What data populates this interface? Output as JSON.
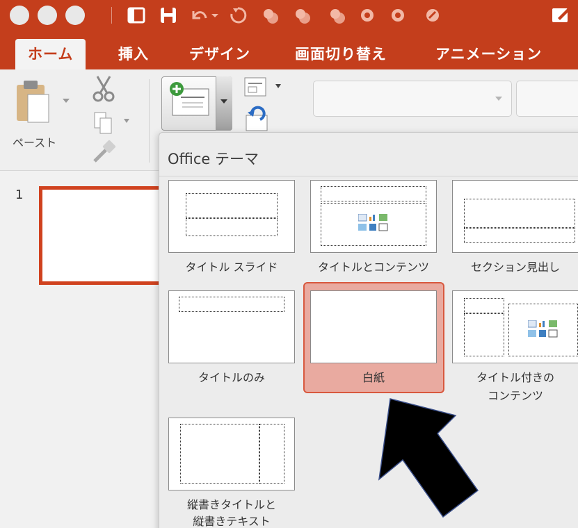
{
  "window": {
    "traffic_lights": [
      "close",
      "minimize",
      "zoom"
    ],
    "quick_access": [
      "sidebar-icon",
      "save-icon",
      "undo-icon",
      "redo-icon",
      "record-icon",
      "record-icon",
      "record-icon",
      "record-icon",
      "record-icon",
      "edit-icon"
    ]
  },
  "tabs": [
    {
      "label": "ホーム",
      "active": true
    },
    {
      "label": "挿入",
      "active": false
    },
    {
      "label": "デザイン",
      "active": false
    },
    {
      "label": "画面切り替え",
      "active": false
    },
    {
      "label": "アニメーション",
      "active": false
    }
  ],
  "ribbon": {
    "paste_label": "ペースト"
  },
  "slides": {
    "number": "1"
  },
  "layout_gallery": {
    "title": "Office テーマ",
    "layouts": [
      {
        "label": "タイトル スライド"
      },
      {
        "label": "タイトルとコンテンツ"
      },
      {
        "label": "セクション見出し"
      },
      {
        "label": "タイトルのみ"
      },
      {
        "label": "白紙",
        "selected": true
      },
      {
        "label_line1": "タイトル付きの",
        "label_line2": "コンテンツ"
      },
      {
        "label_line1": "縦書きタイトルと",
        "label_line2": "縦書きテキスト"
      }
    ]
  },
  "colors": {
    "brand": "#c43e1c",
    "selected_fill": "#e9aaa0",
    "selected_border": "#d8583e"
  }
}
